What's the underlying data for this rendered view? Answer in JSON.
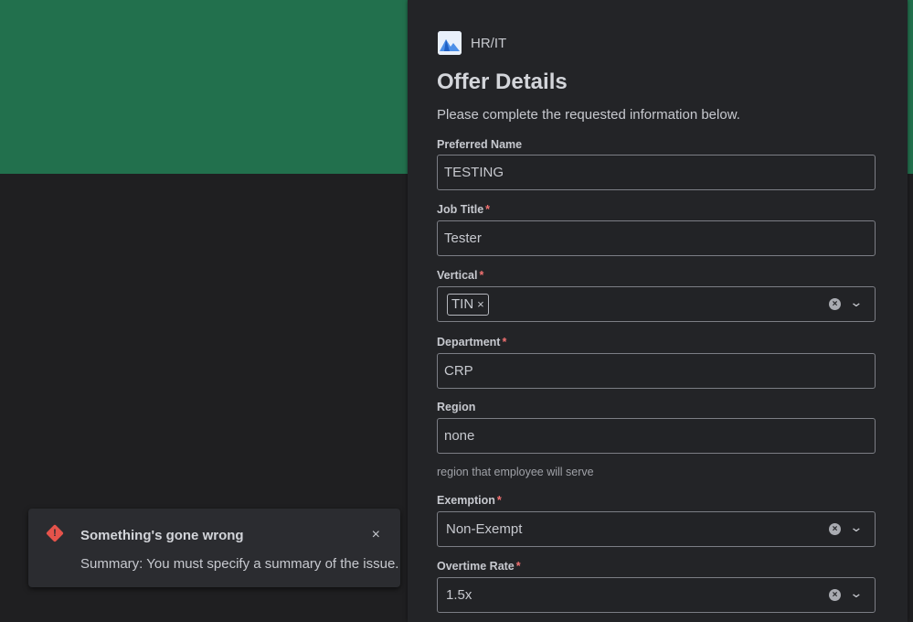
{
  "brand": {
    "name": "HR/IT",
    "icon": "landscape-logo-icon"
  },
  "form": {
    "title": "Offer Details",
    "subtitle": "Please complete the requested information below.",
    "required_marker": "*",
    "fields": {
      "preferred_name": {
        "label": "Preferred Name",
        "value": "TESTING"
      },
      "job_title": {
        "label": "Job Title",
        "value": "Tester"
      },
      "vertical": {
        "label": "Vertical",
        "tag": "TIN",
        "tag_remove": "×"
      },
      "department": {
        "label": "Department",
        "value": "CRP"
      },
      "region": {
        "label": "Region",
        "value": "none",
        "helper": "region that employee will serve"
      },
      "exemption": {
        "label": "Exemption",
        "value": "Non-Exempt"
      },
      "overtime_rate": {
        "label": "Overtime Rate",
        "value": "1.5x"
      }
    }
  },
  "toast": {
    "title": "Something's gone wrong",
    "message": "Summary: You must specify a summary of the issue.",
    "icon": "error-diamond-icon",
    "close_glyph": "×"
  },
  "colors": {
    "banner": "#22704d",
    "background": "#1f1f21",
    "panel": "#232427",
    "required": "#f27171",
    "error": "#e5534b"
  }
}
